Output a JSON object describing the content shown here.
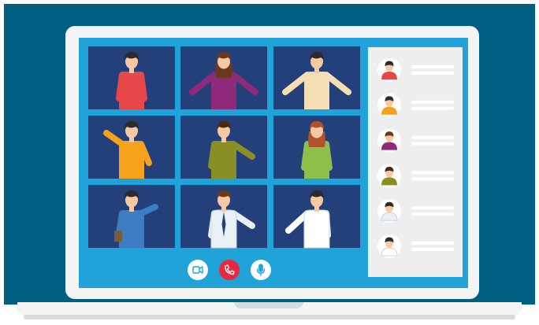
{
  "participants": [
    {
      "shirt": "#e8474a",
      "hair": "#2b2b2b",
      "pose": "arms-down"
    },
    {
      "shirt": "#8e2a79",
      "hair": "#6b3a1e",
      "pose": "arms-open",
      "long_hair": true
    },
    {
      "shirt": "#f5deb3",
      "hair": "#2b2b2b",
      "pose": "shrug"
    },
    {
      "shirt": "#f7a21b",
      "hair": "#2b2b2b",
      "pose": "wave"
    },
    {
      "shirt": "#8a8f25",
      "hair": "#4a2a14",
      "pose": "point"
    },
    {
      "shirt": "#8cc04b",
      "hair": "#b0532b",
      "pose": "arms-down",
      "long_hair": true
    },
    {
      "shirt": "#3d7ec2",
      "hair": "#2b2b2b",
      "pose": "wave-folder"
    },
    {
      "shirt": "#e9f0f8",
      "hair": "#6b3a1e",
      "pose": "point-tie"
    },
    {
      "shirt": "#ffffff",
      "hair": "#2b2b2b",
      "pose": "present"
    }
  ],
  "sidebar_contacts": [
    {
      "shirt": "#e8474a",
      "hair": "#2b2b2b"
    },
    {
      "shirt": "#f7a21b",
      "hair": "#2b2b2b"
    },
    {
      "shirt": "#8e2a79",
      "hair": "#6b3a1e"
    },
    {
      "shirt": "#8a8f25",
      "hair": "#4a2a14"
    },
    {
      "shirt": "#e9f0f8",
      "hair": "#2b2b2b"
    },
    {
      "shirt": "#ffffff",
      "hair": "#2b2b2b"
    }
  ],
  "controls": [
    {
      "name": "camera-button",
      "icon": "camera-icon",
      "bg": "#ffffff",
      "fg": "#1fa3d8"
    },
    {
      "name": "end-call-button",
      "icon": "phone-icon",
      "bg": "#e8283c",
      "fg": "#ffffff"
    },
    {
      "name": "microphone-button",
      "icon": "microphone-icon",
      "bg": "#ffffff",
      "fg": "#1fa3d8"
    }
  ],
  "colors": {
    "background": "#005f82",
    "laptop_frame": "#f4f4f4",
    "screen": "#1fa3d8",
    "tile": "#24407a",
    "sidebar": "#eeeeee",
    "skin": "#f6c9a4"
  }
}
